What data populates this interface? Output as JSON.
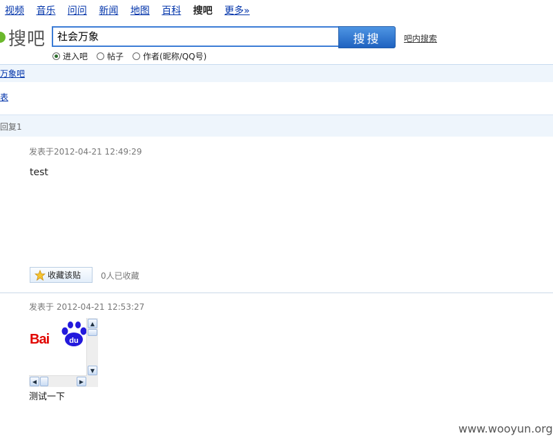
{
  "nav": {
    "items": [
      "视频",
      "音乐",
      "问问",
      "新闻",
      "地图",
      "百科",
      "搜吧",
      "更多»"
    ]
  },
  "logo": {
    "text": "搜吧"
  },
  "search": {
    "value": "社会万象",
    "button_label": "搜搜",
    "in_bar_label": "吧内搜索",
    "options": [
      "进入吧",
      "帖子",
      "作者(昵称/QQ号)"
    ],
    "selected_option": "进入吧"
  },
  "breadcrumb": {
    "bar_link": "万象吧",
    "list_link": "表"
  },
  "thread": {
    "reply_label": "回复1"
  },
  "posts": [
    {
      "meta": "发表于2012-04-21 12:49:29",
      "body": "test",
      "favorite_label": "收藏该贴",
      "favorite_count": "0人已收藏"
    },
    {
      "meta": "发表于  2012-04-21 12:53:27",
      "embed_text": "Bai",
      "embed_badge": "du",
      "caption": "测试一下"
    }
  ],
  "watermark": "www.wooyun.org",
  "colors": {
    "link": "#0033aa",
    "bar_bg": "#eef5fc",
    "button": "#2f74d0",
    "baidu_red": "#e10601",
    "baidu_blue": "#2319dc"
  }
}
